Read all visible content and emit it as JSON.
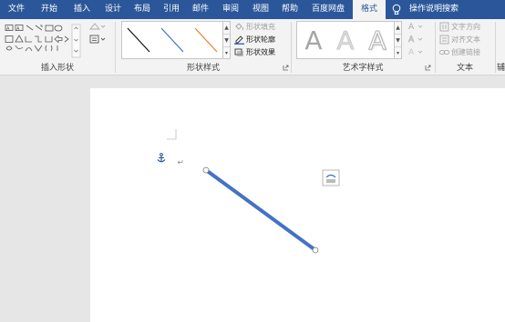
{
  "tabs": [
    {
      "label": "文件",
      "active": false
    },
    {
      "label": "开始",
      "active": false
    },
    {
      "label": "插入",
      "active": false
    },
    {
      "label": "设计",
      "active": false
    },
    {
      "label": "布局",
      "active": false
    },
    {
      "label": "引用",
      "active": false
    },
    {
      "label": "邮件",
      "active": false
    },
    {
      "label": "审阅",
      "active": false
    },
    {
      "label": "视图",
      "active": false
    },
    {
      "label": "帮助",
      "active": false
    },
    {
      "label": "百度网盘",
      "active": false
    },
    {
      "label": "格式",
      "active": true
    }
  ],
  "tell_me": "操作说明搜索",
  "groups": {
    "insert_shapes": "插入形状",
    "shape_styles": "形状样式",
    "wordart_styles": "艺术字样式",
    "text": "文本",
    "aux": "辅"
  },
  "shape_style_commands": {
    "fill": "形状填充",
    "outline": "形状轮廓",
    "effects": "形状效果"
  },
  "text_commands": {
    "direction": "文字方向",
    "align": "对齐文本",
    "link": "创建链接"
  },
  "wordart_letter": "A",
  "colors": {
    "tab_bar": "#2b579a",
    "line_shape": "#4472c4",
    "accent_orange": "#ed7d31"
  }
}
